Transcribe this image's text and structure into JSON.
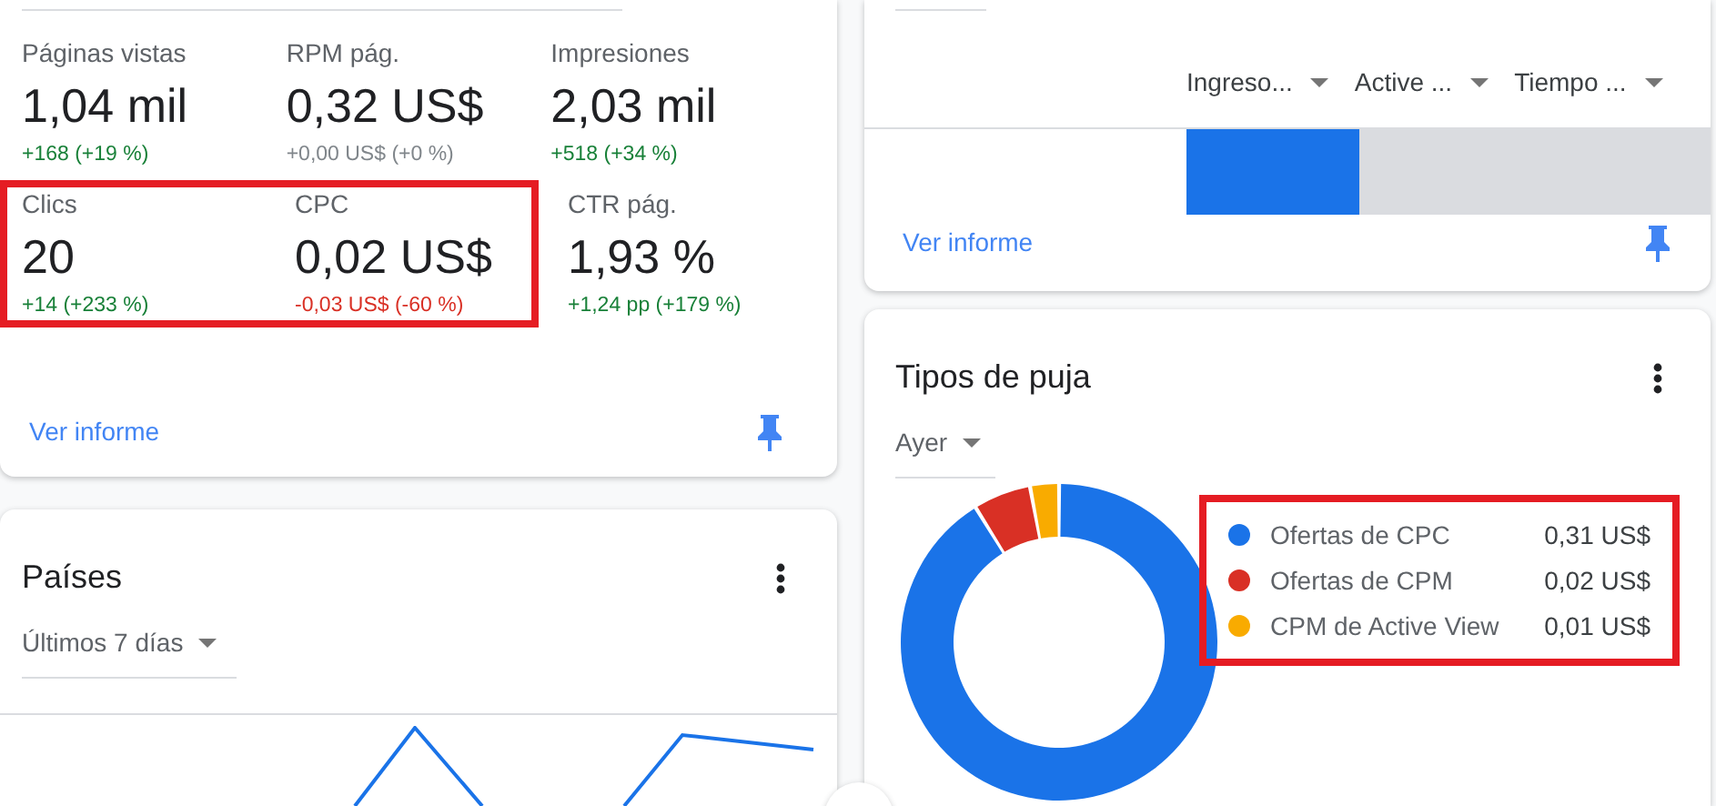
{
  "overview_card": {
    "metrics": [
      {
        "label": "Páginas vistas",
        "value": "1,04 mil",
        "change": "+168 (+19 %)",
        "color": "#188038",
        "highlighted": false
      },
      {
        "label": "RPM pág.",
        "value": "0,32 US$",
        "change": "+0,00 US$ (+0 %)",
        "color": "#80868b",
        "highlighted": false
      },
      {
        "label": "Impresiones",
        "value": "2,03 mil",
        "change": "+518 (+34 %)",
        "color": "#188038",
        "highlighted": false
      },
      {
        "label": "Clics",
        "value": "20",
        "change": "+14 (+233 %)",
        "color": "#188038",
        "highlighted": true
      },
      {
        "label": "CPC",
        "value": "0,02 US$",
        "change": "-0,03 US$ (-60 %)",
        "color": "#d93025",
        "highlighted": true
      },
      {
        "label": "CTR pág.",
        "value": "1,93 %",
        "change": "+1,24 pp (+179 %)",
        "color": "#188038",
        "highlighted": false
      }
    ],
    "link": "Ver informe",
    "pinned": true
  },
  "table_card": {
    "columns": [
      "Ingreso...",
      "Active ...",
      "Tiempo ..."
    ],
    "level": 0.33,
    "link": "Ver informe",
    "pinned": true
  },
  "countries_card": {
    "title": "Países",
    "period": "Últimos 7 días"
  },
  "bid_types_card": {
    "title": "Tipos de puja",
    "period": "Ayer",
    "highlighted": true,
    "chart_data": {
      "type": "donut",
      "legend": "right",
      "categories": [
        "Ofertas de CPC",
        "Ofertas de CPM",
        "CPM de Active View"
      ],
      "values": [
        0.31,
        0.02,
        0.01
      ],
      "colors": [
        "#1a73e8",
        "#d93025",
        "#f9ab00"
      ],
      "value_labels": [
        "0,31 US$",
        "0,02 US$",
        "0,01 US$"
      ]
    }
  }
}
